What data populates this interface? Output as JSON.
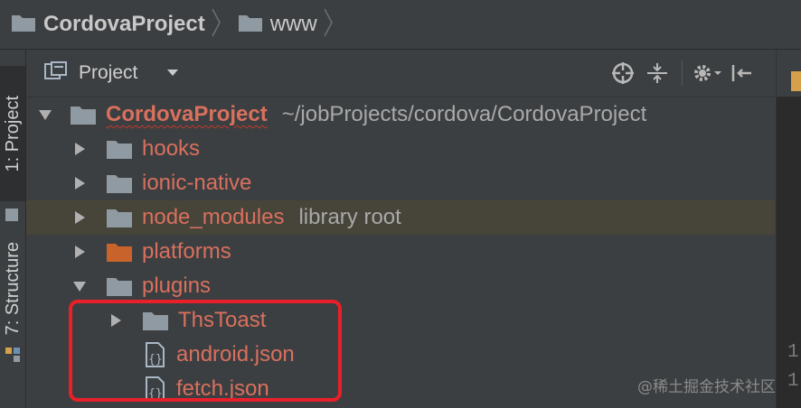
{
  "breadcrumb": [
    {
      "label": "CordovaProject",
      "icon": "folder-icon"
    },
    {
      "label": "www",
      "icon": "folder-icon"
    }
  ],
  "sidebar": {
    "tabs": [
      {
        "label": "1: Project",
        "active": true
      },
      {
        "label": "7: Structure",
        "active": false
      }
    ]
  },
  "panel": {
    "title": "Project",
    "tools": [
      "crosshair-icon",
      "collapse-all-icon",
      "gear-icon",
      "hide-panel-icon"
    ]
  },
  "tree": {
    "root": {
      "name": "CordovaProject",
      "path": "~/jobProjects/cordova/CordovaProject",
      "expanded": true
    },
    "items": [
      {
        "name": "hooks",
        "type": "folder",
        "expanded": false,
        "note": ""
      },
      {
        "name": "ionic-native",
        "type": "folder",
        "expanded": false,
        "note": ""
      },
      {
        "name": "node_modules",
        "type": "folder",
        "expanded": false,
        "note": "library root"
      },
      {
        "name": "platforms",
        "type": "folder-orange",
        "expanded": false,
        "note": ""
      },
      {
        "name": "plugins",
        "type": "folder",
        "expanded": true,
        "note": ""
      },
      {
        "name": "ThsToast",
        "type": "folder",
        "expanded": false,
        "note": ""
      },
      {
        "name": "android.json",
        "type": "json",
        "note": ""
      },
      {
        "name": "fetch.json",
        "type": "json",
        "note": ""
      }
    ]
  },
  "editor": {
    "line_numbers": [
      "1",
      "1"
    ]
  },
  "watermark": "@稀土掘金技术社区",
  "colors": {
    "background": "#3c3f41",
    "tree_text": "#d9705e",
    "highlight_row": "#47443a",
    "annotation_box": "#e8202a",
    "folder": "#8f9aa3",
    "folder_orange": "#c8632c"
  }
}
